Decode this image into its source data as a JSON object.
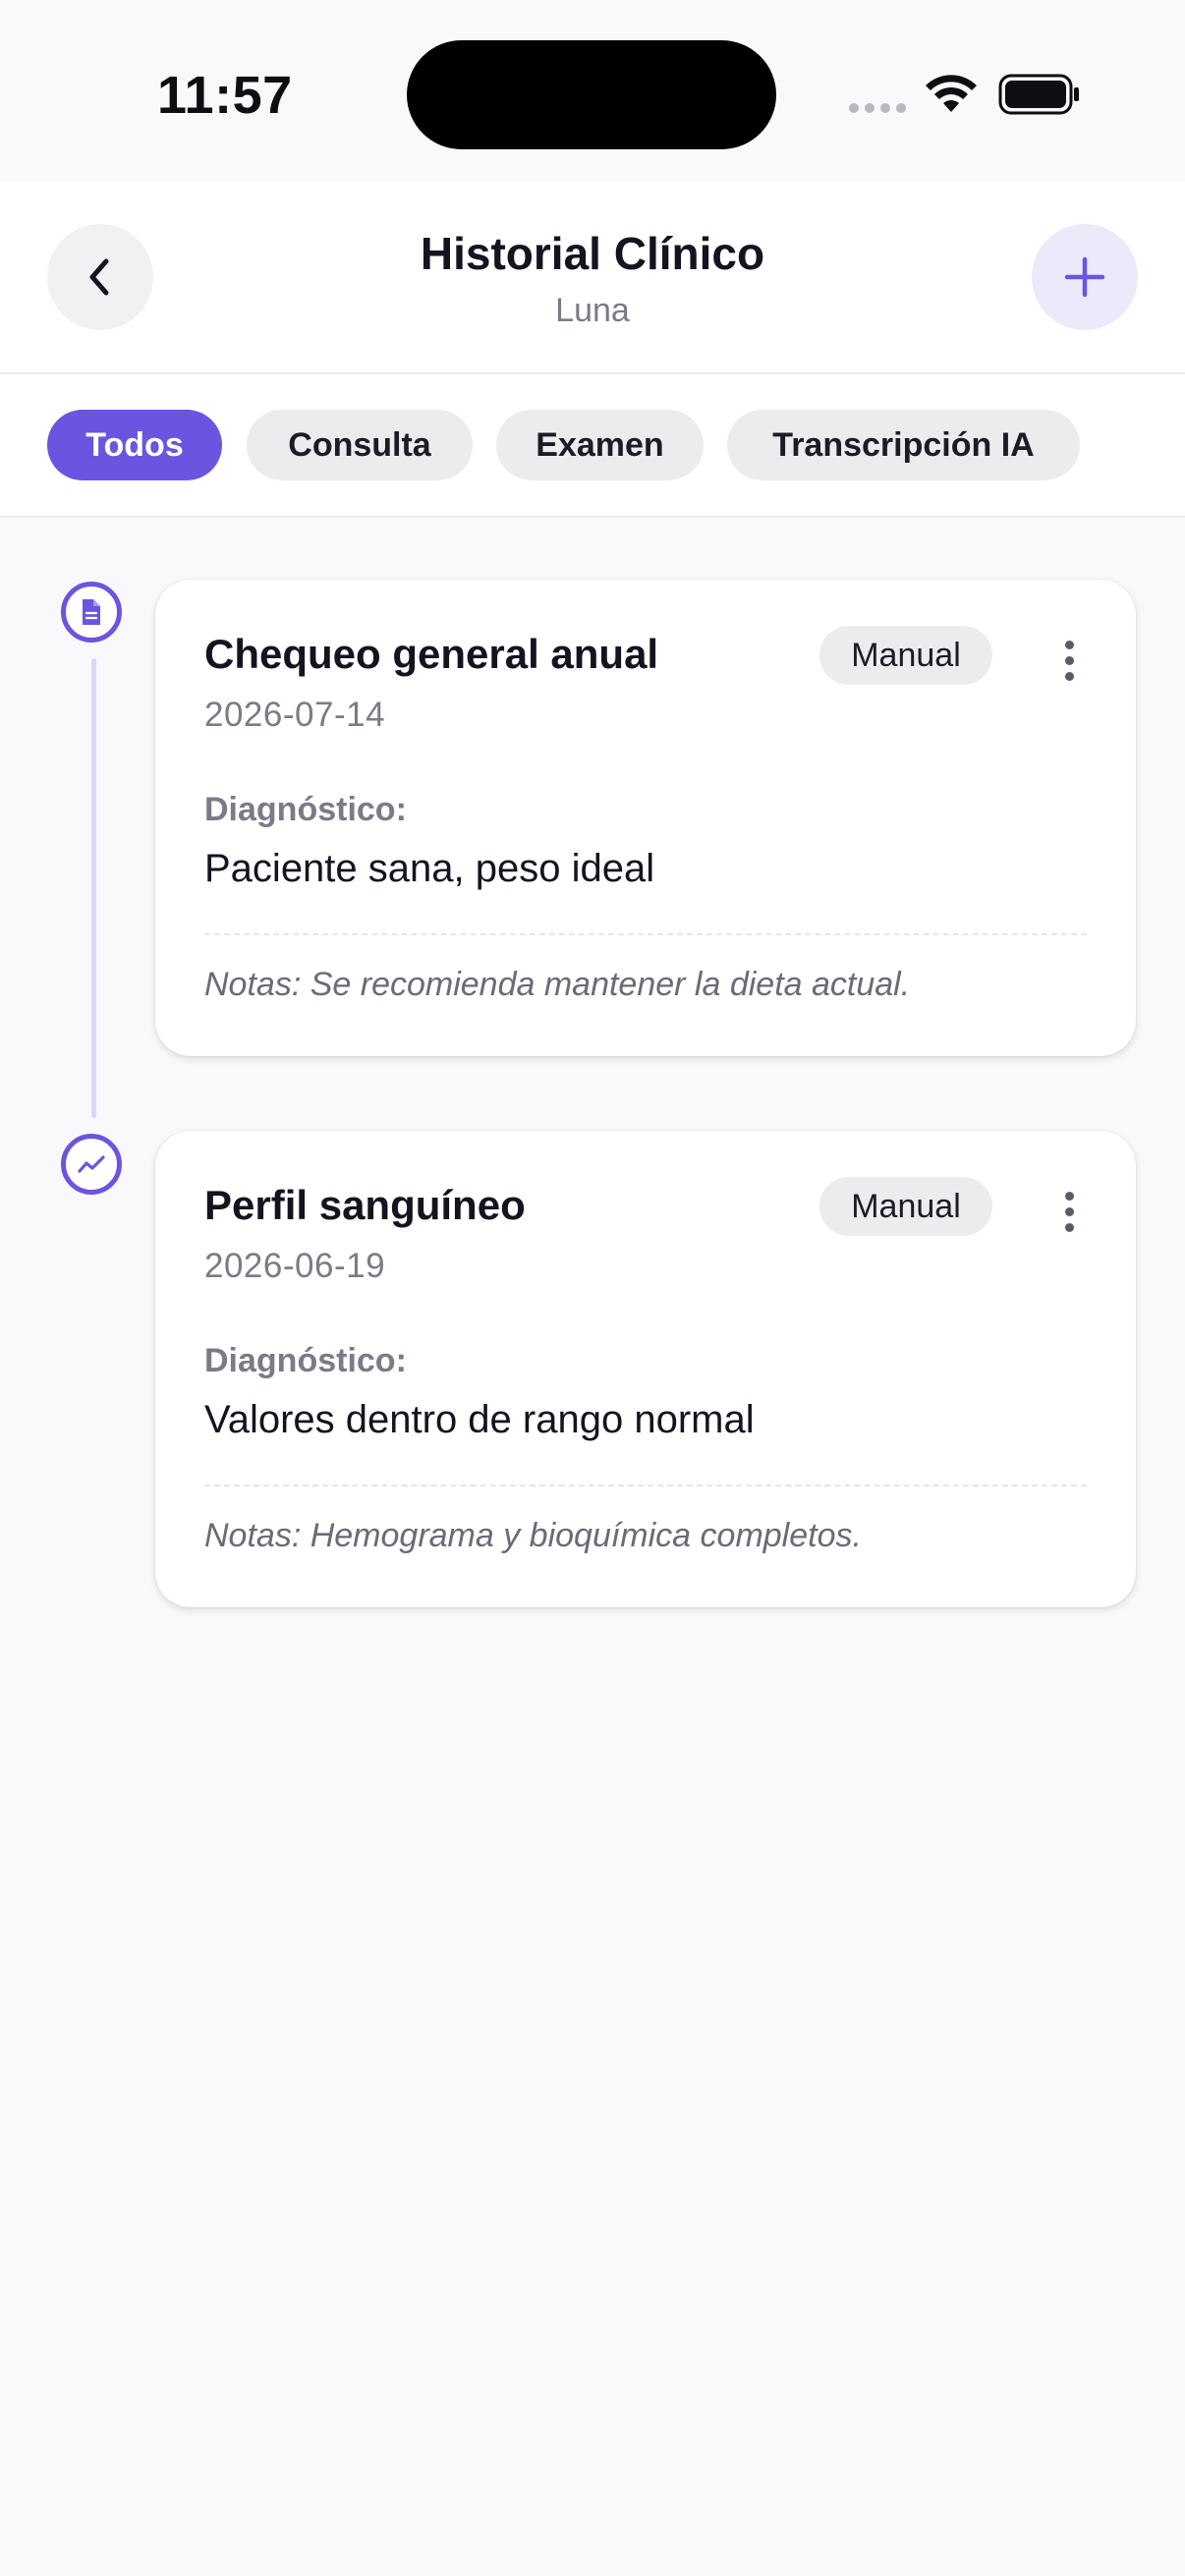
{
  "status_bar": {
    "time": "11:57"
  },
  "header": {
    "title": "Historial Clínico",
    "subtitle": "Luna"
  },
  "filters": [
    "Todos",
    "Consulta",
    "Examen",
    "Transcripción IA"
  ],
  "records": [
    {
      "title": "Chequeo general anual",
      "date": "2026-07-14",
      "badge": "Manual",
      "diagnosis_label": "Diagnóstico:",
      "diagnosis": "Paciente sana, peso ideal",
      "notes": "Notas: Se recomienda mantener la dieta actual.",
      "icon": "document-icon"
    },
    {
      "title": "Perfil sanguíneo",
      "date": "2026-06-19",
      "badge": "Manual",
      "diagnosis_label": "Diagnóstico:",
      "diagnosis": "Valores dentro de rango normal",
      "notes": "Notas: Hemograma y bioquímica completos.",
      "icon": "trend-chart-icon"
    }
  ],
  "colors": {
    "accent": "#6a55e0",
    "accent_light": "#ece9fb",
    "chip_bg": "#ececee",
    "page_bg": "#f9f9fb"
  }
}
